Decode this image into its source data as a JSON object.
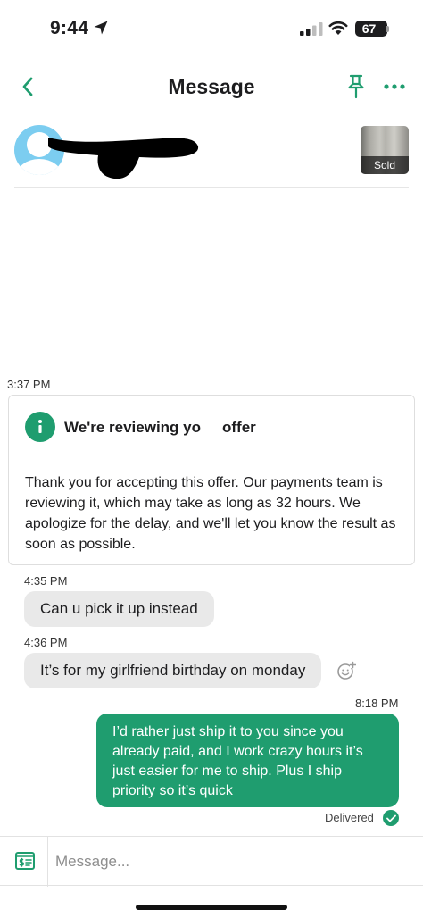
{
  "status_bar": {
    "time": "9:44",
    "battery": "67"
  },
  "header": {
    "title": "Message"
  },
  "listing": {
    "status_badge": "Sold"
  },
  "messages": {
    "system": {
      "time": "3:37 PM",
      "title_left": "We're reviewing yo",
      "title_right": "offer",
      "body": "Thank you for accepting this offer. Our payments team is reviewing it, which may take as long as 32 hours. We apologize for the delay, and we'll let you know the result as soon as possible."
    },
    "incoming_1": {
      "time": "4:35 PM",
      "text": "Can u pick it up instead"
    },
    "incoming_2": {
      "time": "4:36 PM",
      "text": "It’s for my girlfriend birthday on monday"
    },
    "outgoing_1": {
      "time": "8:18 PM",
      "text": "I’d rather just ship it to you since you already paid, and I work crazy hours it’s just easier for me to ship. Plus I ship priority so it’s quick",
      "status": "Delivered"
    }
  },
  "composer": {
    "placeholder": "Message..."
  },
  "colors": {
    "accent": "#1f9d6f",
    "bubble_in": "#e9e9e9",
    "avatar": "#7ccdf0"
  },
  "icons": [
    "location-arrow-icon",
    "signal-icon",
    "wifi-icon",
    "battery-icon",
    "back-chevron-icon",
    "pin-icon",
    "more-icon",
    "info-icon",
    "add-reaction-icon",
    "check-icon",
    "make-offer-icon"
  ]
}
